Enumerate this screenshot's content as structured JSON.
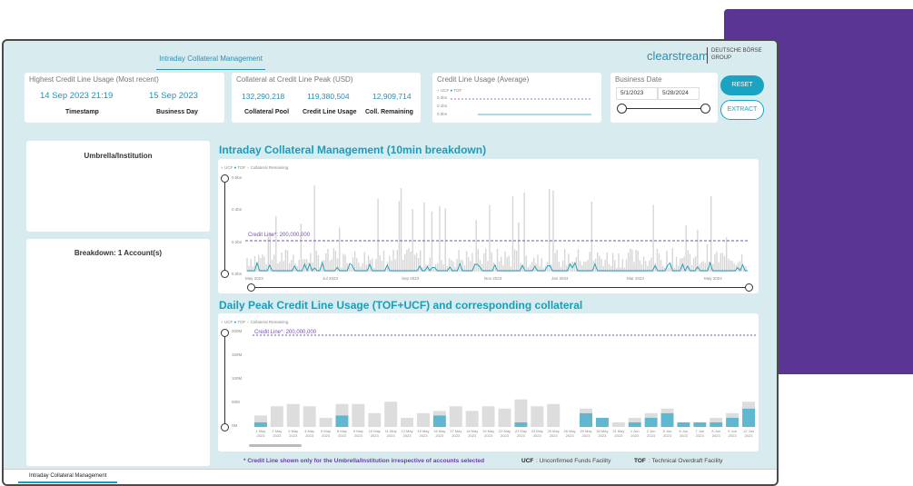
{
  "header": {
    "nav_tab": "Intraday Collateral Management",
    "brand": "clearstream",
    "brand_sub_line1": "DEUTSCHE BÖRSE",
    "brand_sub_line2": "GROUP"
  },
  "kpi_highest": {
    "title": "Highest Credit Line Usage (Most recent)",
    "timestamp_value": "14 Sep 2023 21:19",
    "business_day_value": "15 Sep 2023",
    "timestamp_label": "Timestamp",
    "business_day_label": "Business Day"
  },
  "kpi_collateral": {
    "title": "Collateral at Credit Line Peak (USD)",
    "pool_value": "132,290,218",
    "usage_value": "119,380,504",
    "remaining_value": "12,909,714",
    "pool_label": "Collateral Pool",
    "usage_label": "Credit Line Usage",
    "remaining_label": "Coll. Remaining"
  },
  "kpi_average": {
    "title": "Credit Line Usage (Average)",
    "legend_ucf": "UCF",
    "legend_tof": "TOF",
    "y_ticks": [
      "0.2bn",
      "0.1bn",
      "0.0bn"
    ]
  },
  "business_date": {
    "title": "Business Date",
    "start": "5/1/2023",
    "end": "5/28/2024"
  },
  "buttons": {
    "reset": "RESET",
    "extract": "EXTRACT"
  },
  "left_panels": {
    "umbrella": "Umbrella/Institution",
    "breakdown": "Breakdown: 1 Account(s)"
  },
  "intraday_chart": {
    "section_title": "Intraday Collateral Management (10min breakdown)",
    "legend_ucf": "UCF",
    "legend_tof": "TOF",
    "legend_remaining": "Collateral Remaining",
    "y_ticks": [
      "0.6bn",
      "0.4bn",
      "0.2bn",
      "0.0bn"
    ],
    "x_ticks": [
      "May 2023",
      "Jul 2023",
      "Sep 2023",
      "Nov 2023",
      "Jan 2024",
      "Mar 2024",
      "May 2024"
    ],
    "credit_line_label": "Credit Line*: 200,000,000"
  },
  "daily_chart": {
    "section_title": "Daily Peak Credit Line Usage (TOF+UCF) and corresponding collateral",
    "legend_ucf": "UCF",
    "legend_tof": "TOF",
    "legend_remaining": "Collateral Remaining",
    "y_ticks": [
      "200M",
      "150M",
      "100M",
      "50M",
      "0M"
    ],
    "credit_line_label": "Credit Line*: 200,000,000",
    "x_labels": [
      "1 May",
      "2 May",
      "3 May",
      "4 May",
      "5 May",
      "8 May",
      "9 May",
      "10 May",
      "11 May",
      "12 May",
      "15 May",
      "16 May",
      "17 May",
      "18 May",
      "19 May",
      "22 May",
      "23 May",
      "24 May",
      "25 May",
      "26 May",
      "29 May",
      "30 May",
      "31 May",
      "1 Jun",
      "2 Jun",
      "5 Jun",
      "6 Jun",
      "7 Jun",
      "8 Jun",
      "9 Jun",
      "12 Jun"
    ],
    "x_year": "2023"
  },
  "chart_data": {
    "type": "bar",
    "title": "Daily Peak Credit Line Usage (TOF+UCF) and corresponding collateral",
    "categories": [
      "1 May 2023",
      "2 May 2023",
      "3 May 2023",
      "4 May 2023",
      "5 May 2023",
      "8 May 2023",
      "9 May 2023",
      "10 May 2023",
      "11 May 2023",
      "12 May 2023",
      "15 May 2023",
      "16 May 2023",
      "17 May 2023",
      "18 May 2023",
      "19 May 2023",
      "22 May 2023",
      "23 May 2023",
      "24 May 2023",
      "25 May 2023",
      "26 May 2023",
      "29 May 2023",
      "30 May 2023",
      "31 May 2023",
      "1 Jun 2023",
      "2 Jun 2023",
      "5 Jun 2023",
      "6 Jun 2023",
      "7 Jun 2023",
      "8 Jun 2023",
      "9 Jun 2023",
      "12 Jun 2023"
    ],
    "series": [
      {
        "name": "TOF",
        "values": [
          10,
          0,
          0,
          0,
          0,
          25,
          0,
          0,
          0,
          0,
          0,
          25,
          0,
          0,
          0,
          0,
          10,
          0,
          0,
          0,
          30,
          20,
          0,
          10,
          20,
          30,
          10,
          10,
          10,
          20,
          40
        ]
      },
      {
        "name": "Collateral Remaining",
        "values": [
          15,
          45,
          50,
          45,
          20,
          25,
          50,
          30,
          55,
          20,
          30,
          10,
          45,
          35,
          45,
          40,
          50,
          45,
          50,
          0,
          10,
          0,
          10,
          10,
          10,
          10,
          0,
          0,
          10,
          10,
          15
        ]
      }
    ],
    "ylim": [
      0,
      200
    ],
    "ylabel": "",
    "credit_line": 200
  },
  "footer": {
    "note": "* Credit Line shown only for the Umbrella/Institution irrespective of accounts selected",
    "ucf_key": "UCF",
    "ucf_desc": ": Unconfirmed Funds Facility",
    "tof_key": "TOF",
    "tof_desc": ": Technical Overdraft Facility"
  },
  "page_tab": "Intraday Collateral Management",
  "colors": {
    "accent": "#1a9dbb",
    "bar_grey": "#dddddd",
    "credit_line": "#7a4fb0",
    "purple_block": "#5b3593"
  }
}
